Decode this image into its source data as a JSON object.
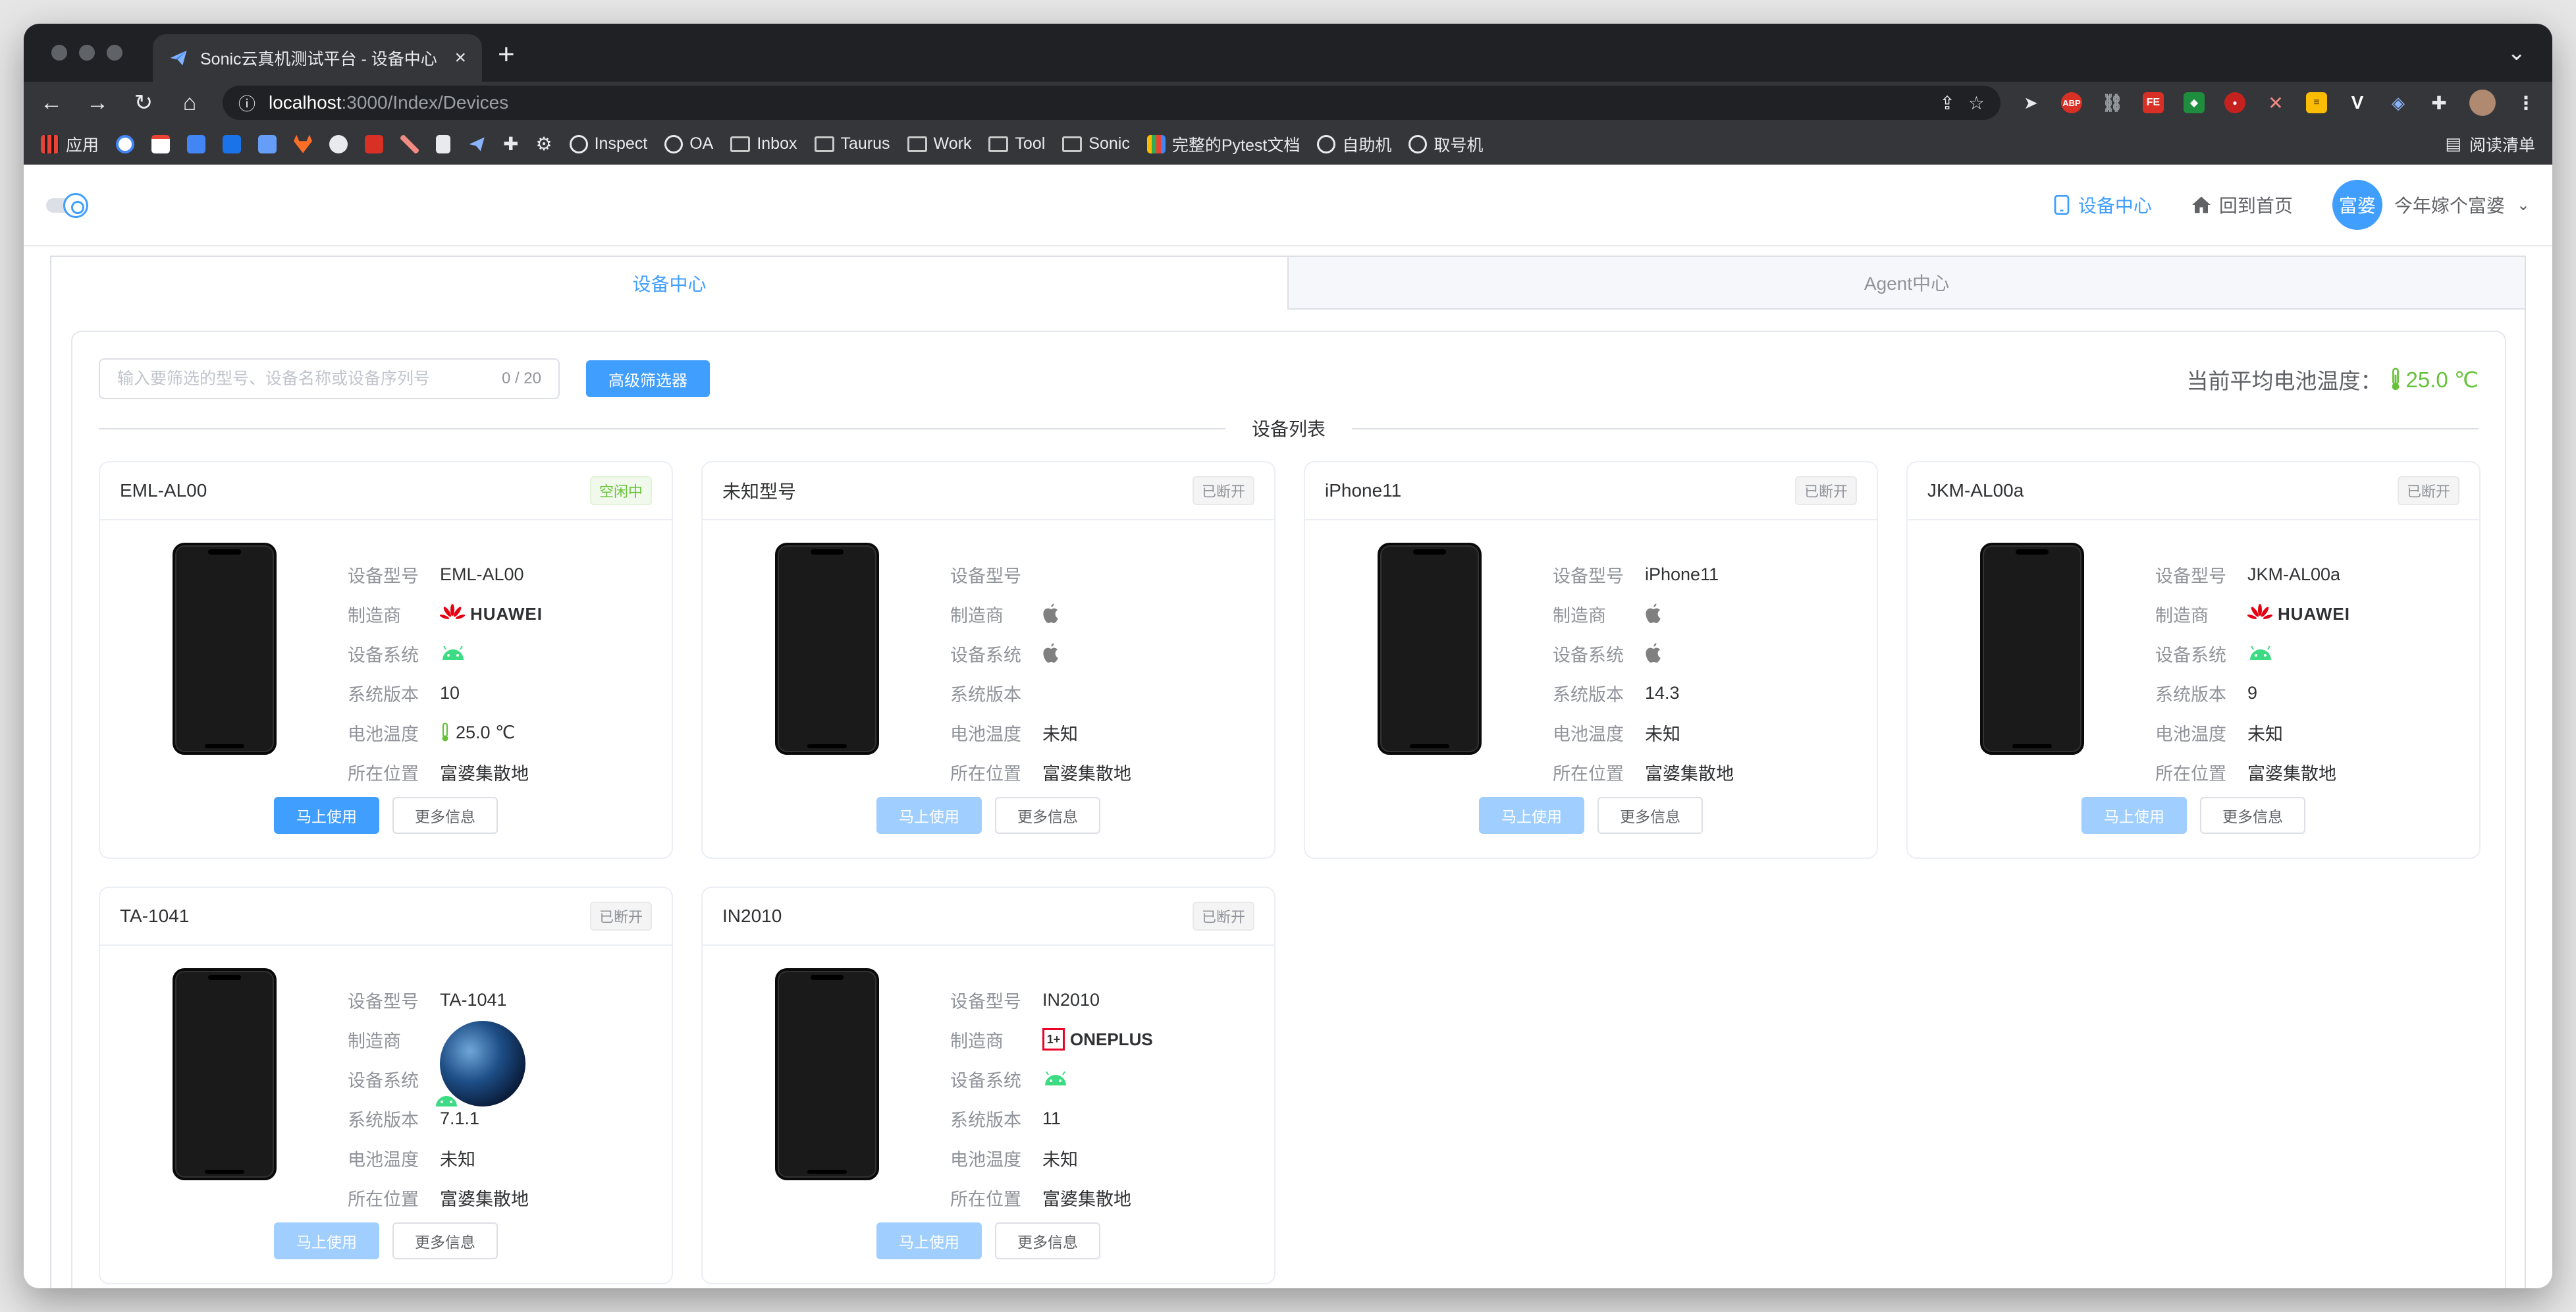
{
  "browser": {
    "tab_title": "Sonic云真机测试平台 - 设备中心",
    "url_host": "localhost",
    "url_rest": ":3000/Index/Devices",
    "bookmarks": {
      "apps": "应用",
      "inspect": "Inspect",
      "oa": "OA",
      "inbox": "Inbox",
      "taurus": "Taurus",
      "work": "Work",
      "tool": "Tool",
      "sonic": "Sonic",
      "pytest": "完整的Pytest文档",
      "self_service": "自助机",
      "take_number": "取号机",
      "reading_list": "阅读清单"
    }
  },
  "header": {
    "device_center": "设备中心",
    "back_home": "回到首页",
    "avatar_text": "富婆",
    "user_name": "今年嫁个富婆"
  },
  "tabs": {
    "device_center": "设备中心",
    "agent_center": "Agent中心"
  },
  "filter": {
    "placeholder": "输入要筛选的型号、设备名称或设备序列号",
    "count": "0 / 20",
    "advanced_button": "高级筛选器"
  },
  "avg_temp": {
    "label": "当前平均电池温度：",
    "value": "25.0 ℃"
  },
  "list_title": "设备列表",
  "labels": {
    "model": "设备型号",
    "manufacturer": "制造商",
    "os": "设备系统",
    "os_version": "系统版本",
    "battery_temp": "电池温度",
    "location": "所在位置",
    "use_now": "马上使用",
    "more_info": "更多信息"
  },
  "devices": [
    {
      "name": "EML-AL00",
      "status": "空闲中",
      "model": "EML-AL00",
      "manufacturer": "HUAWEI",
      "os": "android",
      "version": "10",
      "temp": "25.0 ℃",
      "location": "富婆集散地"
    },
    {
      "name": "未知型号",
      "status": "已断开",
      "model": "",
      "manufacturer": "apple",
      "os": "apple",
      "version": "",
      "temp": "未知",
      "location": "富婆集散地"
    },
    {
      "name": "iPhone11",
      "status": "已断开",
      "model": "iPhone11",
      "manufacturer": "apple",
      "os": "apple",
      "version": "14.3",
      "temp": "未知",
      "location": "富婆集散地"
    },
    {
      "name": "JKM-AL00a",
      "status": "已断开",
      "model": "JKM-AL00a",
      "manufacturer": "HUAWEI",
      "os": "android",
      "version": "9",
      "temp": "未知",
      "location": "富婆集散地"
    },
    {
      "name": "TA-1041",
      "status": "已断开",
      "model": "TA-1041",
      "manufacturer": "globe",
      "os": "android",
      "version": "7.1.1",
      "temp": "未知",
      "location": "富婆集散地"
    },
    {
      "name": "IN2010",
      "status": "已断开",
      "model": "IN2010",
      "manufacturer": "ONEPLUS",
      "os": "android",
      "version": "11",
      "temp": "未知",
      "location": "富婆集散地"
    }
  ],
  "colors": {
    "primary": "#409eff",
    "success": "#67c23a",
    "disabled_primary": "#a0cfff"
  }
}
